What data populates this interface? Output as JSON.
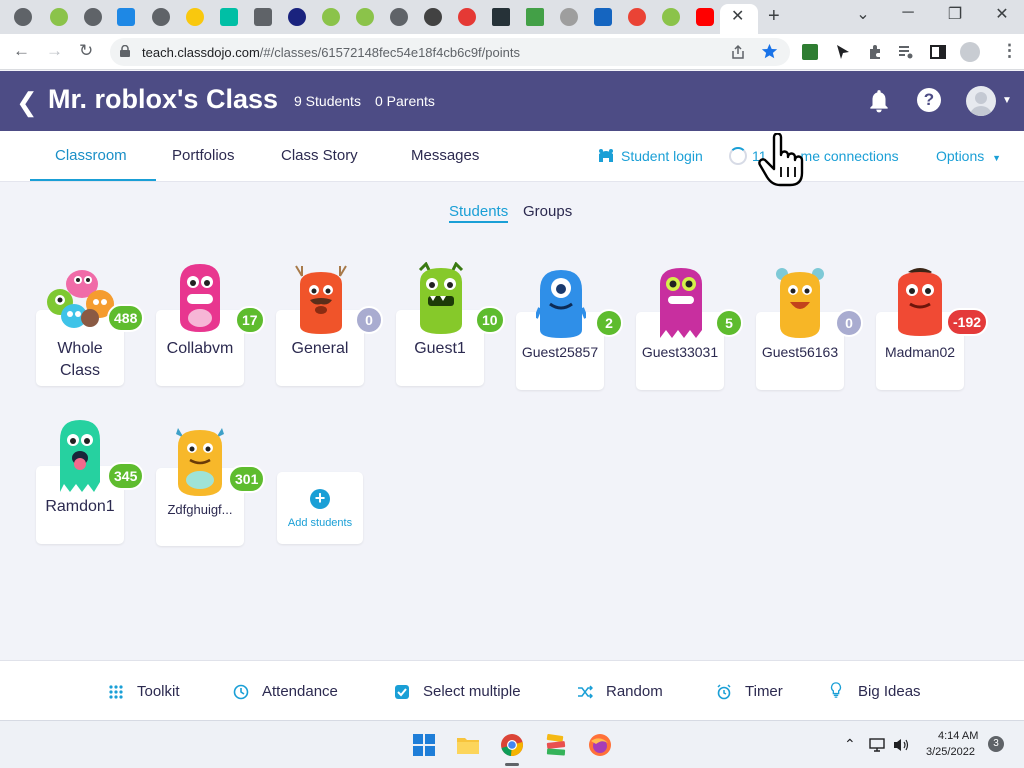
{
  "browser": {
    "url_host": "teach.classdojo.com",
    "url_path": "/#/classes/61572148fec54e18f4cb6c9f/points",
    "tab_close_label": "✕",
    "new_tab_label": "+"
  },
  "header": {
    "title": "Mr. roblox's Class",
    "students_count": "9 Students",
    "parents_count": "0 Parents"
  },
  "tabs": {
    "classroom": "Classroom",
    "portfolios": "Portfolios",
    "class_story": "Class Story",
    "messages": "Messages",
    "student_login": "Student login",
    "home_connections_prefix": "11",
    "home_connections_suffix": "me connections",
    "options": "Options"
  },
  "view_toggle": {
    "students": "Students",
    "groups": "Groups"
  },
  "students": [
    {
      "name_line1": "Whole",
      "name_line2": "Class",
      "points": "488",
      "badge_color": "green"
    },
    {
      "name": "Collabvm",
      "points": "17",
      "badge_color": "green"
    },
    {
      "name": "General",
      "points": "0",
      "badge_color": "grey"
    },
    {
      "name": "Guest1",
      "points": "10",
      "badge_color": "green"
    },
    {
      "name": "Guest25857",
      "points": "2",
      "badge_color": "green"
    },
    {
      "name": "Guest33031",
      "points": "5",
      "badge_color": "green"
    },
    {
      "name": "Guest56163",
      "points": "0",
      "badge_color": "grey"
    },
    {
      "name": "Madman02",
      "points": "-192",
      "badge_color": "red"
    },
    {
      "name": "Ramdon1",
      "points": "345",
      "badge_color": "green"
    },
    {
      "name": "Zdfghuigf...",
      "points": "301",
      "badge_color": "green"
    }
  ],
  "add_students_label": "Add students",
  "toolbar": {
    "toolkit": "Toolkit",
    "attendance": "Attendance",
    "select_multiple": "Select multiple",
    "random": "Random",
    "timer": "Timer",
    "big_ideas": "Big Ideas"
  },
  "taskbar": {
    "time": "4:14 AM",
    "date": "3/25/2022",
    "notification_count": "3"
  },
  "colors": {
    "header_bg": "#4d4c85",
    "accent": "#1a9fd6",
    "badge_green": "#5ebc2e",
    "badge_grey": "#a9acd0",
    "badge_red": "#e43a3a"
  }
}
